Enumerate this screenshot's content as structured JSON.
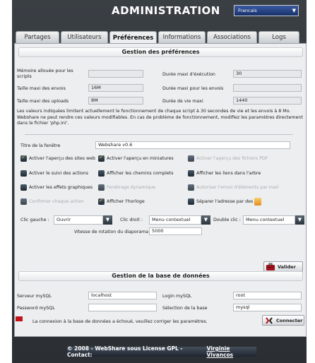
{
  "header": {
    "title": "ADMINISTRATION",
    "language": "Francais"
  },
  "tabs": [
    {
      "label": "Partages"
    },
    {
      "label": "Utilisateurs"
    },
    {
      "label": "Préférences",
      "active": true
    },
    {
      "label": "Informations"
    },
    {
      "label": "Associations"
    },
    {
      "label": "Logs"
    }
  ],
  "prefs": {
    "title": "Gestion des préférences",
    "memory_label": "Mémoire allouée pour les scripts",
    "memory_value": "",
    "exec_label": "Durée maxi d'éxécution",
    "exec_value": "30",
    "post_label": "Taille maxi des envois",
    "post_value": "16M",
    "input_label": "Durée maxi pour les envois",
    "input_value": "",
    "upload_label": "Taille maxi des uploads",
    "upload_value": "8M",
    "life_label": "Durée de vie maxi",
    "life_value": "1440",
    "note": "Les valeurs indiquées limitent actuellement le fonctionnement de chaque script à 30 secondes de vie et les envois à 8 Mo. Webshare ne peut rendre ces valeurs modifiables. En cas de problème de fonctionnement, modifiez les paramètres directement dans le fichier 'php.ini'.",
    "window_title_label": "Titre de la fenêtre",
    "window_title_value": "Webshare v0.6",
    "checkboxes": [
      {
        "label": "Activer l'aperçu des sites web",
        "checked": true,
        "disabled": false
      },
      {
        "label": "Activer l'aperçu en miniatures",
        "checked": true,
        "disabled": false
      },
      {
        "label": "Activer l'aperçu des fichiers PDF",
        "checked": false,
        "disabled": true
      },
      {
        "label": "Activer le suivi des actions",
        "checked": false,
        "disabled": false
      },
      {
        "label": "Afficher les chemins complets",
        "checked": false,
        "disabled": false
      },
      {
        "label": "Afficher les liens dans l'arbre",
        "checked": false,
        "disabled": false
      },
      {
        "label": "Activer les effets graphiques",
        "checked": false,
        "disabled": false
      },
      {
        "label": "Fenêtrage dynamique",
        "checked": false,
        "disabled": true
      },
      {
        "label": "Autoriser l'envoi d'éléments par mail",
        "checked": false,
        "disabled": true
      },
      {
        "label": "Confirmer chaque action",
        "checked": false,
        "disabled": true
      },
      {
        "label": "Afficher l'horloge",
        "checked": true,
        "disabled": false
      },
      {
        "label": "Séparer l'adresse par des",
        "checked": false,
        "disabled": false
      }
    ],
    "left_click_label": "Clic gauche :",
    "left_click_value": "Ouvrir",
    "right_click_label": "Clic droit :",
    "right_click_value": "Menu contextuel",
    "double_click_label": "Double clic :",
    "double_click_value": "Menu contextuel",
    "slideshow_label": "Vitesse de rotation du diaporama",
    "slideshow_value": "5000",
    "save_label": "Valider"
  },
  "db": {
    "title": "Gestion de la base de données",
    "server_label": "Serveur mySQL",
    "server_value": "localhost",
    "login_label": "Login mySQL",
    "login_value": "root",
    "password_label": "Password mySQL",
    "password_value": "",
    "base_label": "Sélection de la base",
    "base_value": "mysql",
    "status_text": "La connexion à la base de données a échoué, veuillez corriger les paramètres.",
    "connect_label": "Connecter"
  },
  "footer": {
    "text": "© 2008 - WebShare sous License GPL - Contact:",
    "contact": "Virginie Vivancos"
  },
  "colors": {
    "frame": "#2b2f33",
    "panel": "#eceeef",
    "accent": "#17306b",
    "error": "#c0141a"
  }
}
